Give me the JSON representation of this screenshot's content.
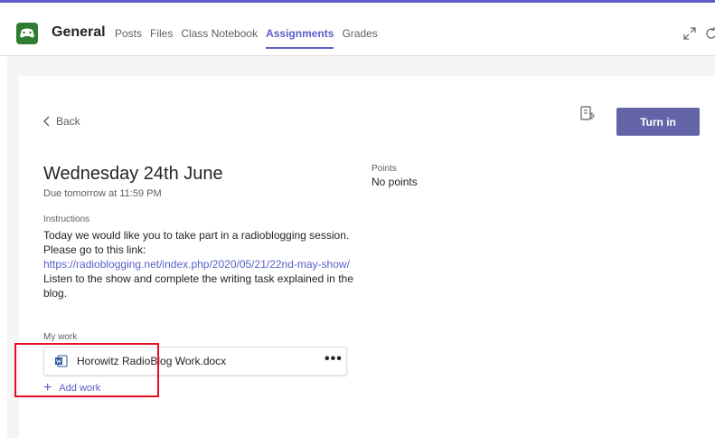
{
  "header": {
    "channel": "General",
    "tabs": [
      {
        "label": "Posts",
        "active": false
      },
      {
        "label": "Files",
        "active": false
      },
      {
        "label": "Class Notebook",
        "active": false
      },
      {
        "label": "Assignments",
        "active": true
      },
      {
        "label": "Grades",
        "active": false
      }
    ]
  },
  "toolbar": {
    "back_label": "Back",
    "turn_in_label": "Turn in"
  },
  "assignment": {
    "title": "Wednesday 24th June",
    "due": "Due tomorrow at 11:59 PM",
    "points_label": "Points",
    "points_value": "No points",
    "instructions_label": "Instructions",
    "instructions_line1": "Today we would like you to take part in a radioblogging session. Please go to this link: ",
    "instructions_link": "https://radioblogging.net/index.php/2020/05/21/22nd-may-show/",
    "instructions_line2": "Listen to the show and complete the writing task explained in the blog."
  },
  "my_work": {
    "label": "My work",
    "file_name": "Horowitz RadioBlog Work.docx",
    "add_work_label": "Add work"
  },
  "colors": {
    "accent": "#5b5fc7",
    "button": "#6264a7",
    "highlight": "#e81123"
  }
}
